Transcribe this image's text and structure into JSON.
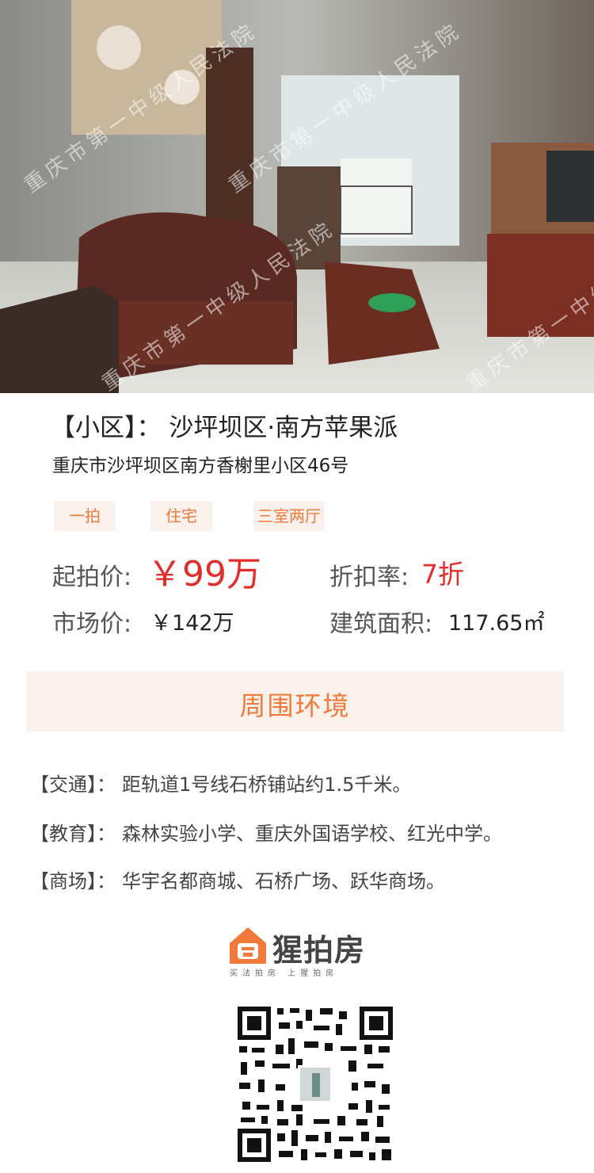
{
  "photo": {
    "alt": "living room photo",
    "watermark": "重庆市第一中级人民法院"
  },
  "listing": {
    "title": "【小区】： 沙坪坝区·南方苹果派",
    "address": "重庆市沙坪坝区南方香榭里小区46号",
    "tags": [
      "一拍",
      "住宅",
      "三室两厅"
    ],
    "start_price_label": "起拍价:",
    "start_price_value": "￥99万",
    "discount_label": "折扣率:",
    "discount_value": "7折",
    "market_price_label": "市场价:",
    "market_price_value": "￥142万",
    "area_label": "建筑面积:",
    "area_value": "117.65㎡"
  },
  "environment": {
    "title": "周围环境",
    "items": [
      {
        "label": "【交通】：",
        "text": "距轨道1号线石桥铺站约1.5千米。"
      },
      {
        "label": "【教育】：",
        "text": "森林实验小学、重庆外国语学校、红光中学。"
      },
      {
        "label": "【商场】：",
        "text": "华宇名都商城、石桥广场、跃华商场。"
      }
    ]
  },
  "brand": {
    "name": "猩拍房",
    "slogan": "买法拍房 上猩拍房",
    "accent": "#f07a3a"
  },
  "colors": {
    "accent": "#f07a3a",
    "price_red": "#e32d2d",
    "tag_bg": "#fbf1ec"
  }
}
